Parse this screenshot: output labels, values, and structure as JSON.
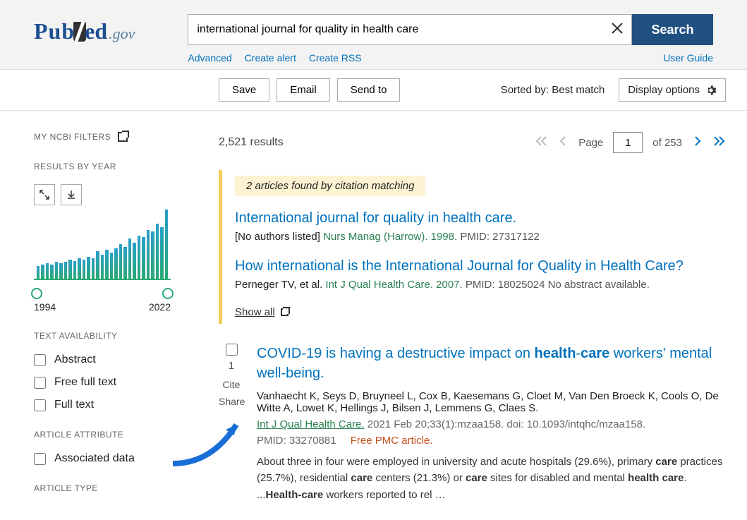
{
  "header": {
    "logo_pub": "Pub",
    "logo_med": "ed",
    "logo_gov": ".gov",
    "search_value": "international journal for quality in health care",
    "search_button": "Search",
    "links": {
      "advanced": "Advanced",
      "create_alert": "Create alert",
      "create_rss": "Create RSS",
      "user_guide": "User Guide"
    }
  },
  "toolbar": {
    "save": "Save",
    "email": "Email",
    "send_to": "Send to",
    "sorted_by": "Sorted by: Best match",
    "display_options": "Display options"
  },
  "sidebar": {
    "my_filters": "MY NCBI FILTERS",
    "results_by_year": "RESULTS BY YEAR",
    "year_start": "1994",
    "year_end": "2022",
    "text_availability": "TEXT AVAILABILITY",
    "abstract": "Abstract",
    "free_full_text": "Free full text",
    "full_text": "Full text",
    "article_attribute": "ARTICLE ATTRIBUTE",
    "associated_data": "Associated data",
    "article_type": "ARTICLE TYPE"
  },
  "results": {
    "count": "2,521 results",
    "page_label": "Page",
    "page_value": "1",
    "of_pages": "of 253"
  },
  "citation": {
    "banner": "2 articles found by citation matching",
    "items": [
      {
        "title": "International journal for quality in health care.",
        "authors": "[No authors listed]",
        "journal": "Nurs Manag (Harrow). 1998.",
        "pmid": "PMID: 27317122"
      },
      {
        "title": "How international is the International Journal for Quality in Health Care?",
        "authors": "Perneger TV, et al.",
        "journal": "Int J Qual Health Care. 2007.",
        "pmid": "PMID: 18025024 No abstract available."
      }
    ],
    "show_all": "Show all"
  },
  "result1": {
    "index": "1",
    "cite": "Cite",
    "share": "Share",
    "title_pre": "COVID-19 is having a destructive impact on ",
    "title_b1": "health",
    "title_dash": "-",
    "title_b2": "care",
    "title_post": " workers' mental well-being.",
    "authors": "Vanhaecht K, Seys D, Bruyneel L, Cox B, Kaesemans G, Cloet M, Van Den Broeck K, Cools O, De Witte A, Lowet K, Hellings J, Bilsen J, Lemmens G, Claes S.",
    "journal": "Int J Qual Health Care.",
    "pub_rest": " 2021 Feb 20;33(1):mzaa158. doi: 10.1093/intqhc/mzaa158.",
    "pmid": "PMID: 33270881",
    "free": "Free PMC article.",
    "snippet_a": "About three in four were employed in university and acute hospitals (29.6%), primary ",
    "snippet_b1": "care",
    "snippet_b": " practices (25.7%), residential ",
    "snippet_b2": "care",
    "snippet_c": " centers (21.3%) or ",
    "snippet_b3": "care",
    "snippet_d": " sites for disabled and mental ",
    "snippet_b4": "health care",
    "snippet_e": ". ...",
    "snippet_b5": "Health-care",
    "snippet_f": " workers reported to rel …"
  },
  "chart_data": {
    "type": "bar",
    "x_start": 1994,
    "x_end": 2022,
    "values": [
      18,
      20,
      22,
      20,
      25,
      22,
      24,
      28,
      26,
      30,
      28,
      32,
      30,
      40,
      35,
      42,
      38,
      44,
      50,
      46,
      58,
      52,
      62,
      60,
      70,
      68,
      80,
      75,
      100
    ],
    "ylim": [
      0,
      100
    ]
  }
}
